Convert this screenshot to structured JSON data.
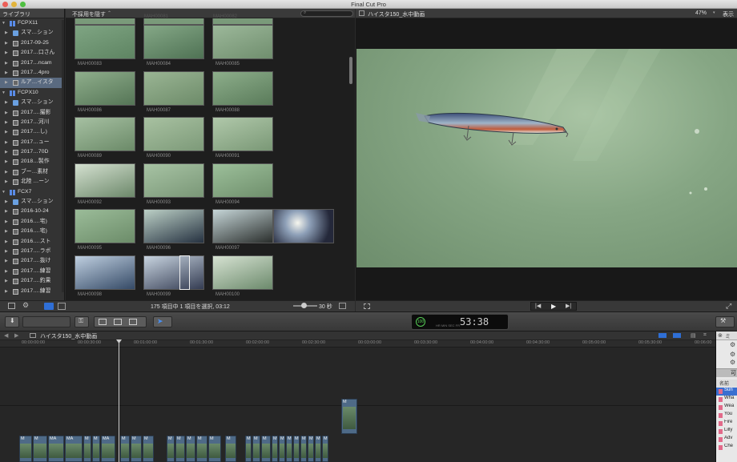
{
  "app": {
    "title": "Final Cut Pro"
  },
  "library": {
    "header": "ライブラリ",
    "items": [
      {
        "label": "FCPX11",
        "level": 0,
        "icon": "library-icon",
        "open": true
      },
      {
        "label": "スマ…ション",
        "level": 1,
        "icon": "smart-collection-folder-icon"
      },
      {
        "label": "2017-09-25",
        "level": 1,
        "icon": "event-icon"
      },
      {
        "label": "2017…口さん",
        "level": 1,
        "icon": "event-icon"
      },
      {
        "label": "2017…ncam",
        "level": 1,
        "icon": "event-icon"
      },
      {
        "label": "2017…4pro",
        "level": 1,
        "icon": "event-icon"
      },
      {
        "label": "ルア…イスタ",
        "level": 1,
        "icon": "event-icon",
        "selected": true
      },
      {
        "label": "FCPX10",
        "level": 0,
        "icon": "library-icon",
        "open": true
      },
      {
        "label": "スマ…ション",
        "level": 1,
        "icon": "smart-collection-folder-icon"
      },
      {
        "label": "2017….撮影",
        "level": 1,
        "icon": "event-icon"
      },
      {
        "label": "2017…河川",
        "level": 1,
        "icon": "event-icon"
      },
      {
        "label": "2017….し)",
        "level": 1,
        "icon": "event-icon"
      },
      {
        "label": "2017…ュー",
        "level": 1,
        "icon": "event-icon"
      },
      {
        "label": "2017…70D",
        "level": 1,
        "icon": "event-icon"
      },
      {
        "label": "2018…製作",
        "level": 1,
        "icon": "event-icon"
      },
      {
        "label": "ブー…素材",
        "level": 1,
        "icon": "event-icon"
      },
      {
        "label": "北陸 …ーン",
        "level": 1,
        "icon": "event-icon"
      },
      {
        "label": "FCX7",
        "level": 0,
        "icon": "library-icon",
        "open": true
      },
      {
        "label": "スマ…ション",
        "level": 1,
        "icon": "smart-collection-folder-icon"
      },
      {
        "label": "2016-10-24",
        "level": 1,
        "icon": "event-icon"
      },
      {
        "label": "2016….宅)",
        "level": 1,
        "icon": "event-icon"
      },
      {
        "label": "2016….宅)",
        "level": 1,
        "icon": "event-icon"
      },
      {
        "label": "2016….スト",
        "level": 1,
        "icon": "event-icon"
      },
      {
        "label": "2017….ラボ",
        "level": 1,
        "icon": "event-icon"
      },
      {
        "label": "2017….抜け",
        "level": 1,
        "icon": "event-icon"
      },
      {
        "label": "2017….練習",
        "level": 1,
        "icon": "event-icon"
      },
      {
        "label": "2017….釣果",
        "level": 1,
        "icon": "event-icon"
      },
      {
        "label": "2017….練習",
        "level": 1,
        "icon": "event-icon"
      }
    ]
  },
  "browser": {
    "filter": "不採用を隠す",
    "status": "175 項目中 1 項目を選択, 03:12",
    "zoom_label": "30 秒",
    "partial_labels": [
      "MAH00081",
      "MAH00082"
    ],
    "clips": [
      [
        "MAH00083",
        "MAH00084",
        "MAH00085"
      ],
      [
        "MAH00086",
        "MAH00087",
        "MAH00088"
      ],
      [
        "MAH00089",
        "MAH00090",
        "MAH00091"
      ],
      [
        "MAH00092",
        "MAH00093",
        "MAH00094"
      ],
      [
        "MAH00095",
        "MAH00096",
        "MAH00097"
      ],
      [
        "MAH00098",
        "MAH00099",
        "MAH00100"
      ]
    ]
  },
  "viewer": {
    "title": "ハイスタ150_水中動画",
    "zoom": "47%",
    "display": "表示"
  },
  "timecode": {
    "value": "53:38",
    "mode": "100",
    "units": [
      "HR",
      "MIN",
      "SEC",
      "FR"
    ]
  },
  "timeline": {
    "project": "ハイスタ150_水中動画",
    "ruler": [
      "00:00:00:00",
      "00:00:30:00",
      "00:01:00:00",
      "00:01:30:00",
      "00:02:00:00",
      "00:02:30:00",
      "00:03:00:00",
      "00:03:30:00",
      "00:04:00:00",
      "00:04:30:00",
      "00:05:00:00",
      "00:05:30:00",
      "00:06:00"
    ],
    "clips": [
      "M",
      "M",
      "MA",
      "MA",
      "M",
      "M",
      "MA",
      "M",
      "M",
      "M",
      "M",
      "M",
      "M",
      "M",
      "M",
      "M",
      "M",
      "M",
      "M",
      "M",
      "M",
      "M",
      "M",
      "M",
      "M",
      "M",
      "M"
    ],
    "connected_clip": "M"
  },
  "index": {
    "header": "ミ",
    "name_col": "名前",
    "items": [
      "Sun",
      "Wha",
      "Wea",
      "You",
      "Fire",
      "Lilly",
      "Adv",
      "Che"
    ]
  },
  "colors": {
    "accent": "#2f6fd6",
    "selection": "#5a6a80",
    "clip": "#4e6a87",
    "water": "#86a684"
  }
}
